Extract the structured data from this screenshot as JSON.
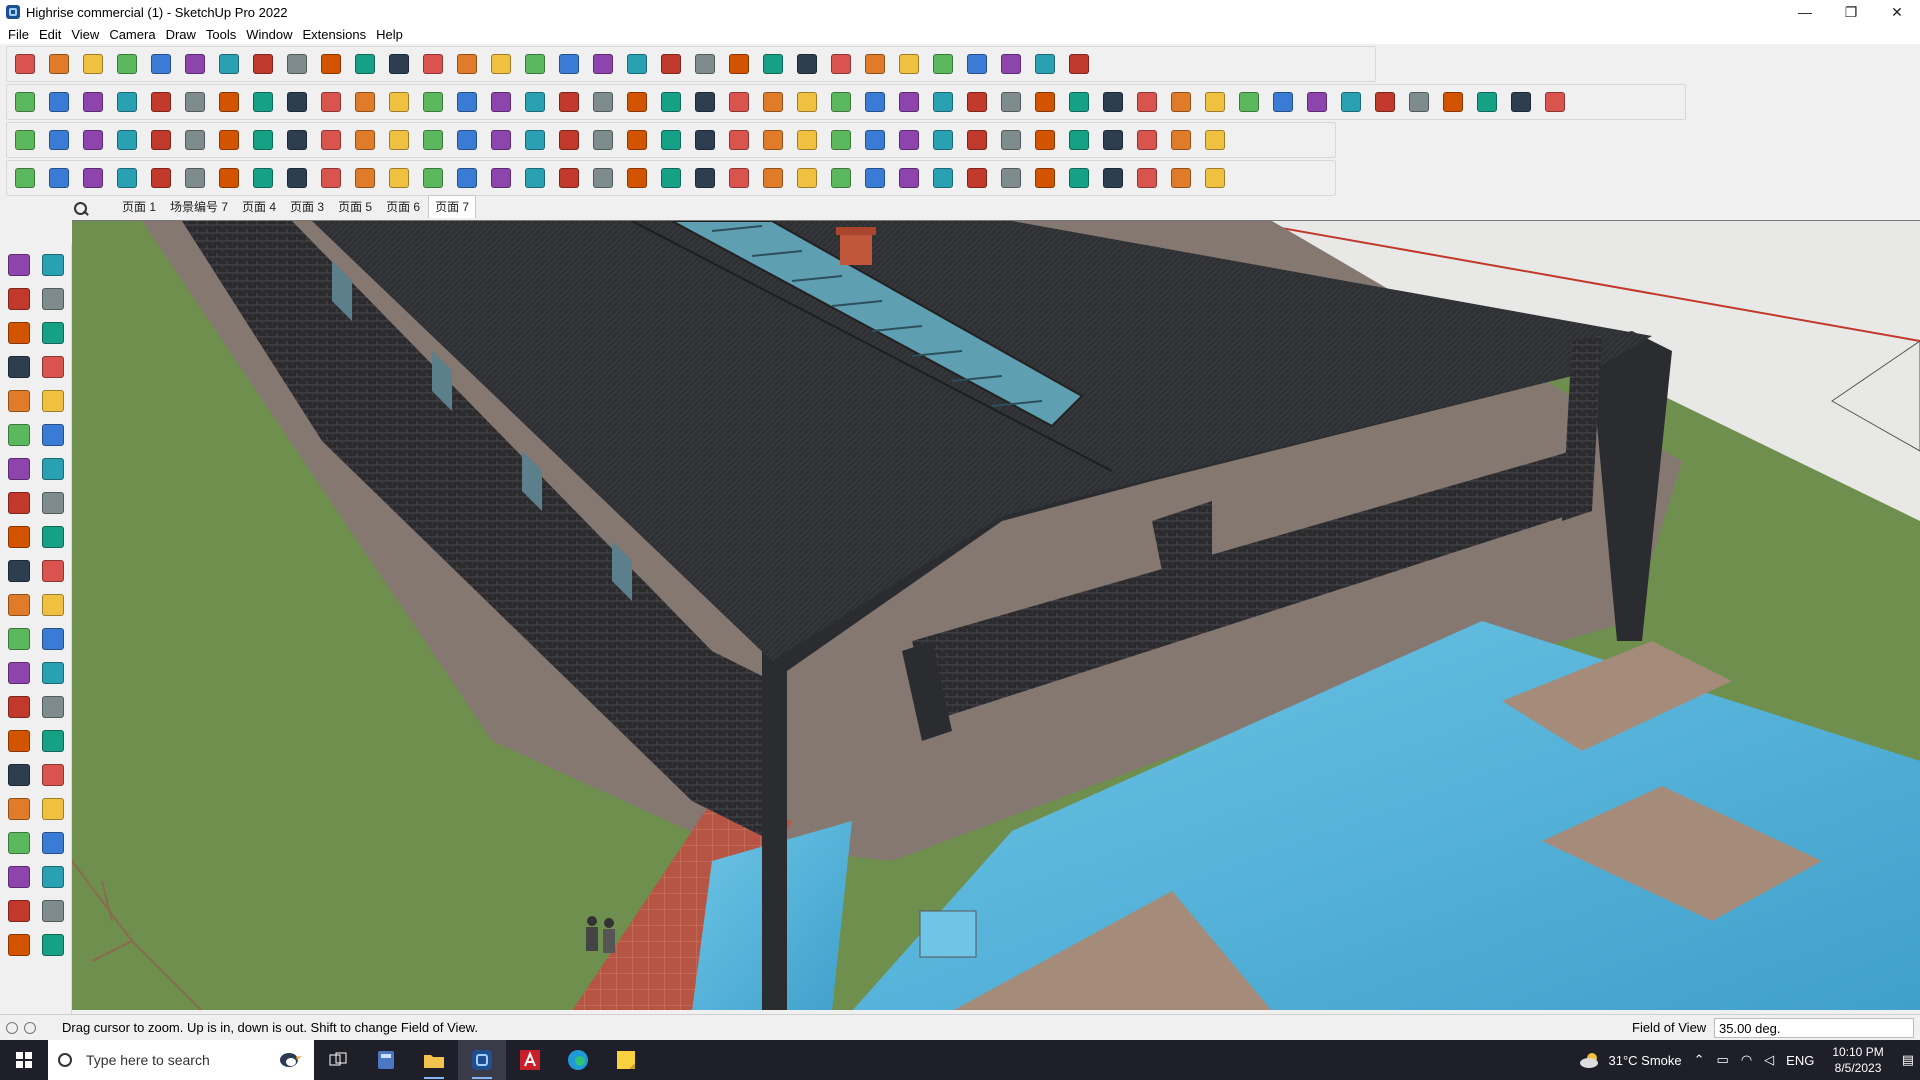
{
  "window": {
    "title": "Highrise commercial (1) - SketchUp Pro 2022",
    "controls": {
      "minimize": "—",
      "restore": "❐",
      "close": "✕"
    }
  },
  "menu": {
    "items": [
      "File",
      "Edit",
      "View",
      "Camera",
      "Draw",
      "Tools",
      "Window",
      "Extensions",
      "Help"
    ]
  },
  "scenes": {
    "tabs": [
      "页面 1",
      "场景编号 7",
      "页面 4",
      "页面 3",
      "页面 5",
      "页面 6",
      "页面 7"
    ],
    "active_index": 6
  },
  "status": {
    "hint": "Drag cursor to zoom.  Up is in, down is out. Shift to change Field of View.",
    "vcb_label": "Field of View",
    "vcb_value": "35.00 deg."
  },
  "taskbar": {
    "search_placeholder": "Type here to search",
    "weather": "31°C  Smoke",
    "language": "ENG",
    "time": "10:10 PM",
    "date": "8/5/2023"
  },
  "icons": {
    "toolbar_row1": [
      "zoom-icon",
      "select-icon",
      "eraser-icon",
      "pencil-icon",
      "lasso-icon",
      "rectangle-icon",
      "push-pull-icon",
      "follow-me-icon",
      "move-icon",
      "rotate-icon",
      "scale-icon",
      "tape-measure-icon",
      "text-icon",
      "paint-bucket-icon",
      "orbit-icon",
      "pan-icon",
      "zoom-window-icon",
      "zoom-extents-icon",
      "component-icon",
      "layer-icon",
      "outliner-icon",
      "tag-icon",
      "geo-location-icon",
      "section-plane-icon",
      "section-cut-icon",
      "add-location-icon",
      "sandbox-icon",
      "extrude-icon",
      "intersect-icon",
      "undo-icon",
      "redo-icon",
      "warehouse-icon"
    ],
    "toolbar_row2_count": 46,
    "toolbar_row3_count": 36,
    "toolbar_row4_count": 36,
    "left_toolbar_count": 42
  },
  "colors": {
    "chrome_bg": "#f0f0f0",
    "ground": "#6f8f4e",
    "pavement": "#847871",
    "roof": "#2f3135",
    "brick": "#2a2a2c",
    "water": "#52b2d6",
    "deck": "#a58c7a",
    "glass": "#6fa9bd",
    "chimney": "#c0573a",
    "taskbar": "#1f1f2a"
  }
}
